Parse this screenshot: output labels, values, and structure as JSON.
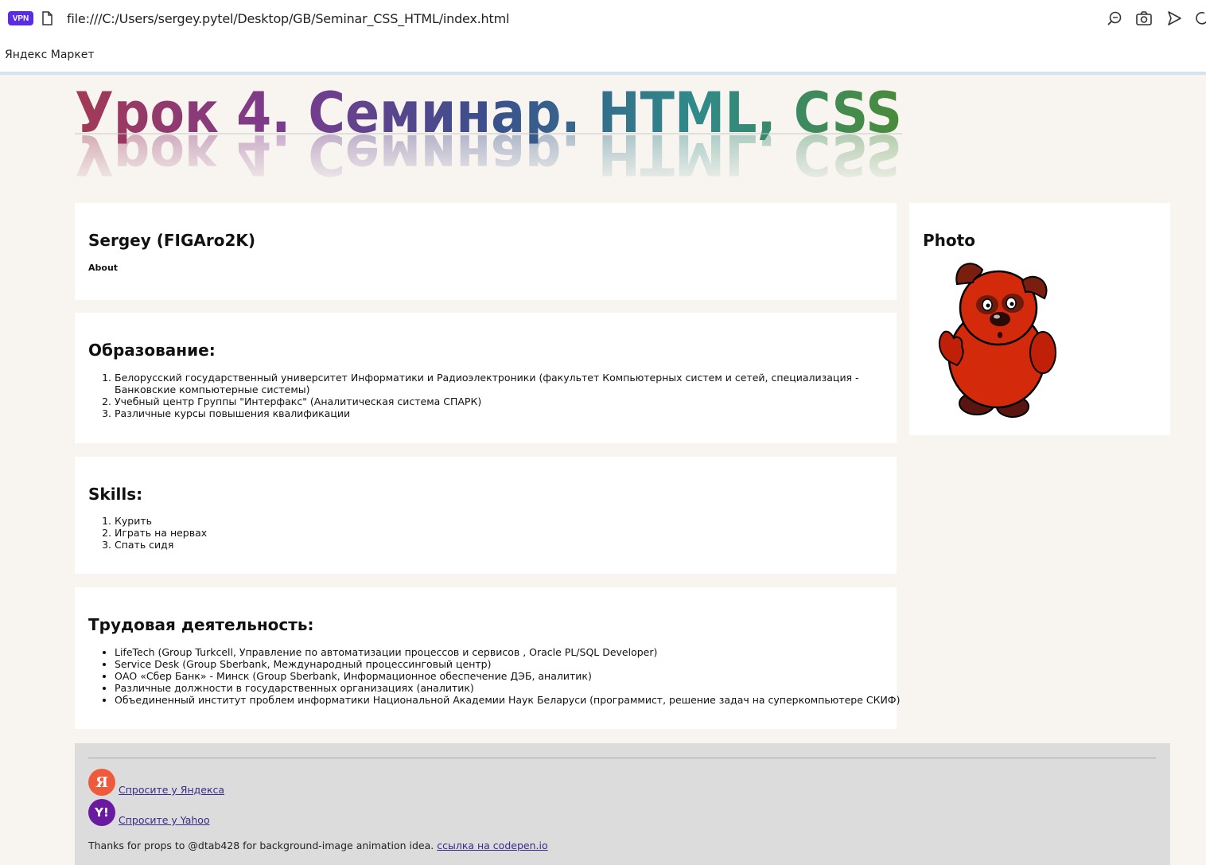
{
  "browser": {
    "vpn_label": "VPN",
    "url": "file:///C:/Users/sergey.pytel/Desktop/GB/Seminar_CSS_HTML/index.html",
    "bookmark": "Яндекс Маркет"
  },
  "hero": {
    "title": "Урок 4. Семинар. HTML, CSS",
    "gradient": [
      "#a23a55",
      "#7b3b8e",
      "#3b4f8c",
      "#2f8a8a",
      "#4a8b3a"
    ]
  },
  "profile": {
    "name": "Sergey (FIGAro2K)",
    "about": "About"
  },
  "education": {
    "heading": "Образование:",
    "items": [
      "Белорусский государственный университет Информатики и Радиоэлектроники (факультет Компьютерных систем и сетей, специализация - Банковские компьютерные системы)",
      "Учебный центр Группы \"Интерфакс\" (Аналитическая система СПАРК)",
      "Различные курсы повышения квалификации"
    ]
  },
  "skills": {
    "heading": "Skills:",
    "items": [
      "Курить",
      "Играть на нервах",
      "Спать сидя"
    ]
  },
  "work": {
    "heading": "Трудовая деятельность:",
    "items": [
      "LifeTech (Group Turkcell, Управление по автоматизации процессов и сервисов , Oracle PL/SQL Developer)",
      "Service Desk (Group Sberbank, Международный процессинговый центр)",
      "ОАО «Сбер Банк» - Минск (Group Sberbank, Информационное обеспечение ДЭБ, аналитик)",
      "Различные должности в государственных организациях (аналитик)",
      "Объединенный институт проблем информатики Национальной Академии Наук Беларуси (программист, решение задач на суперкомпьютере СКИФ)"
    ]
  },
  "photo": {
    "heading": "Photo"
  },
  "footer": {
    "yandex_link": "Спросите у Яндекса",
    "yandex_badge": "Я",
    "yahoo_link": "Спросите у Yahoo",
    "yahoo_badge": "Y!",
    "credit_text": "Thanks for props to @dtab428 for background-image animation idea.",
    "credit_link": "ссылка на codepen.io"
  }
}
